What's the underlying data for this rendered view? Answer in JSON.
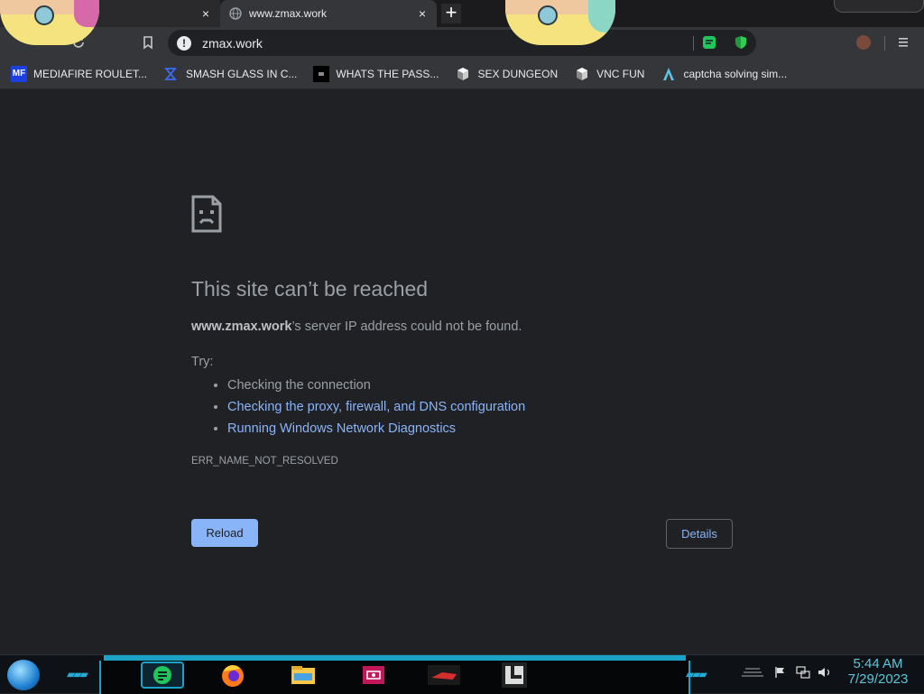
{
  "tabs": [
    {
      "title": "",
      "close_icon": "×"
    },
    {
      "title": "www.zmax.work",
      "close_icon": "×"
    }
  ],
  "new_tab_icon": "+",
  "omnibox": {
    "url": "zmax.work",
    "info_icon": "!"
  },
  "bookmarks": [
    {
      "label": "MEDIAFIRE ROULET...",
      "icon": "mediafire-icon"
    },
    {
      "label": "SMASH GLASS IN C...",
      "icon": "chevron-logo-icon"
    },
    {
      "label": "WHATS THE PASS...",
      "icon": "dark-site-icon"
    },
    {
      "label": "SEX DUNGEON",
      "icon": "cube-icon"
    },
    {
      "label": "VNC FUN",
      "icon": "cube-icon"
    },
    {
      "label": "captcha solving sim...",
      "icon": "triangle-logo-icon"
    }
  ],
  "error": {
    "title": "This site can’t be reached",
    "host": "www.zmax.work",
    "desc_suffix": "’s server IP address could not be found.",
    "try_label": "Try:",
    "suggestions": [
      "Checking the connection",
      "Checking the proxy, firewall, and DNS configuration",
      "Running Windows Network Diagnostics"
    ],
    "code": "ERR_NAME_NOT_RESOLVED",
    "reload_label": "Reload",
    "details_label": "Details"
  },
  "taskbar": {
    "time": "5:44 AM",
    "date": "7/29/2023"
  },
  "colors": {
    "page_bg": "#202124",
    "link": "#8ab4f8",
    "accent": "#1aa3c6"
  }
}
